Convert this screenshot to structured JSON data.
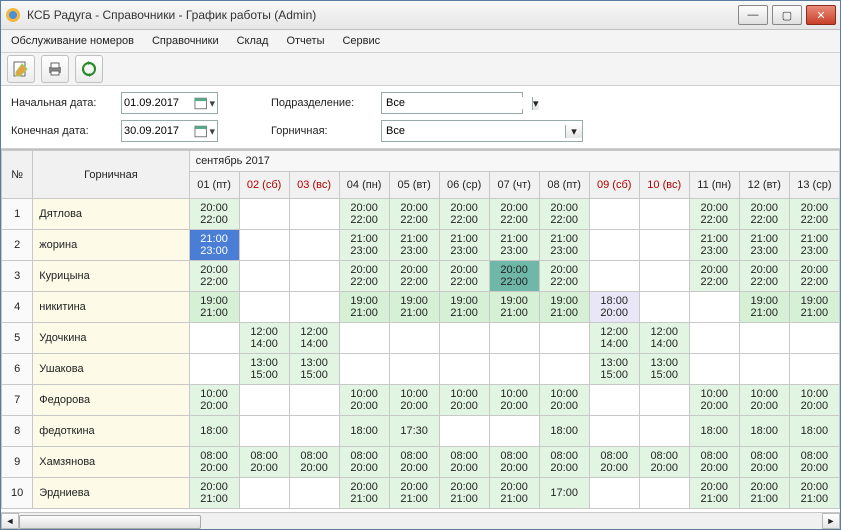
{
  "window": {
    "title": "КСБ Радуга - Справочники - График работы (Admin)"
  },
  "menubar": [
    "Обслуживание номеров",
    "Справочники",
    "Склад",
    "Отчеты",
    "Сервис"
  ],
  "filters": {
    "start_label": "Начальная дата:",
    "start_value": "01.09.2017",
    "end_label": "Конечная дата:",
    "end_value": "30.09.2017",
    "dept_label": "Подразделение:",
    "dept_value": "Все",
    "maid_label": "Горничная:",
    "maid_value": "Все"
  },
  "grid": {
    "num_header": "№",
    "name_header": "Горничная",
    "month_header": "сентябрь 2017",
    "days": [
      {
        "label": "01 (пт)",
        "weekend": false
      },
      {
        "label": "02 (сб)",
        "weekend": true
      },
      {
        "label": "03 (вс)",
        "weekend": true
      },
      {
        "label": "04 (пн)",
        "weekend": false
      },
      {
        "label": "05 (вт)",
        "weekend": false
      },
      {
        "label": "06 (ср)",
        "weekend": false
      },
      {
        "label": "07 (чт)",
        "weekend": false
      },
      {
        "label": "08 (пт)",
        "weekend": false
      },
      {
        "label": "09 (сб)",
        "weekend": true
      },
      {
        "label": "10 (вс)",
        "weekend": true
      },
      {
        "label": "11 (пн)",
        "weekend": false
      },
      {
        "label": "12 (вт)",
        "weekend": false
      },
      {
        "label": "13 (ср)",
        "weekend": false
      }
    ],
    "rows": [
      {
        "num": "1",
        "name": "Дятлова",
        "cells": [
          {
            "t1": "20:00",
            "t2": "22:00",
            "cls": "shift"
          },
          {
            "cls": ""
          },
          {
            "cls": ""
          },
          {
            "t1": "20:00",
            "t2": "22:00",
            "cls": "shift"
          },
          {
            "t1": "20:00",
            "t2": "22:00",
            "cls": "shift"
          },
          {
            "t1": "20:00",
            "t2": "22:00",
            "cls": "shift"
          },
          {
            "t1": "20:00",
            "t2": "22:00",
            "cls": "shift"
          },
          {
            "t1": "20:00",
            "t2": "22:00",
            "cls": "shift"
          },
          {
            "cls": ""
          },
          {
            "cls": ""
          },
          {
            "t1": "20:00",
            "t2": "22:00",
            "cls": "shift"
          },
          {
            "t1": "20:00",
            "t2": "22:00",
            "cls": "shift"
          },
          {
            "t1": "20:00",
            "t2": "22:00",
            "cls": "shift"
          }
        ]
      },
      {
        "num": "2",
        "name": "жорина",
        "cells": [
          {
            "t1": "21:00",
            "t2": "23:00",
            "cls": "sel-blue"
          },
          {
            "cls": ""
          },
          {
            "cls": ""
          },
          {
            "t1": "21:00",
            "t2": "23:00",
            "cls": "shift"
          },
          {
            "t1": "21:00",
            "t2": "23:00",
            "cls": "shift"
          },
          {
            "t1": "21:00",
            "t2": "23:00",
            "cls": "shift"
          },
          {
            "t1": "21:00",
            "t2": "23:00",
            "cls": "shift"
          },
          {
            "t1": "21:00",
            "t2": "23:00",
            "cls": "shift"
          },
          {
            "cls": ""
          },
          {
            "cls": ""
          },
          {
            "t1": "21:00",
            "t2": "23:00",
            "cls": "shift"
          },
          {
            "t1": "21:00",
            "t2": "23:00",
            "cls": "shift"
          },
          {
            "t1": "21:00",
            "t2": "23:00",
            "cls": "shift"
          }
        ]
      },
      {
        "num": "3",
        "name": "Курицына",
        "cells": [
          {
            "t1": "20:00",
            "t2": "22:00",
            "cls": "shift"
          },
          {
            "cls": ""
          },
          {
            "cls": ""
          },
          {
            "t1": "20:00",
            "t2": "22:00",
            "cls": "shift"
          },
          {
            "t1": "20:00",
            "t2": "22:00",
            "cls": "shift"
          },
          {
            "t1": "20:00",
            "t2": "22:00",
            "cls": "shift"
          },
          {
            "t1": "20:00",
            "t2": "22:00",
            "cls": "sel-teal"
          },
          {
            "t1": "20:00",
            "t2": "22:00",
            "cls": "shift"
          },
          {
            "cls": ""
          },
          {
            "cls": ""
          },
          {
            "t1": "20:00",
            "t2": "22:00",
            "cls": "shift"
          },
          {
            "t1": "20:00",
            "t2": "22:00",
            "cls": "shift"
          },
          {
            "t1": "20:00",
            "t2": "22:00",
            "cls": "shift"
          }
        ]
      },
      {
        "num": "4",
        "name": "никитина",
        "cells": [
          {
            "t1": "19:00",
            "t2": "21:00",
            "cls": "shift-alt"
          },
          {
            "cls": ""
          },
          {
            "cls": ""
          },
          {
            "t1": "19:00",
            "t2": "21:00",
            "cls": "shift-alt"
          },
          {
            "t1": "19:00",
            "t2": "21:00",
            "cls": "shift-alt"
          },
          {
            "t1": "19:00",
            "t2": "21:00",
            "cls": "shift-alt"
          },
          {
            "t1": "19:00",
            "t2": "21:00",
            "cls": "shift-alt"
          },
          {
            "t1": "19:00",
            "t2": "21:00",
            "cls": "shift-alt"
          },
          {
            "t1": "18:00",
            "t2": "20:00",
            "cls": "sel-lav"
          },
          {
            "cls": ""
          },
          {
            "cls": ""
          },
          {
            "t1": "19:00",
            "t2": "21:00",
            "cls": "shift-alt"
          },
          {
            "t1": "19:00",
            "t2": "21:00",
            "cls": "shift-alt"
          }
        ]
      },
      {
        "num": "5",
        "name": "Удочкина",
        "cells": [
          {
            "cls": ""
          },
          {
            "t1": "12:00",
            "t2": "14:00",
            "cls": "shift"
          },
          {
            "t1": "12:00",
            "t2": "14:00",
            "cls": "shift"
          },
          {
            "cls": ""
          },
          {
            "cls": ""
          },
          {
            "cls": ""
          },
          {
            "cls": ""
          },
          {
            "cls": ""
          },
          {
            "t1": "12:00",
            "t2": "14:00",
            "cls": "shift"
          },
          {
            "t1": "12:00",
            "t2": "14:00",
            "cls": "shift"
          },
          {
            "cls": ""
          },
          {
            "cls": ""
          },
          {
            "cls": ""
          }
        ]
      },
      {
        "num": "6",
        "name": "Ушакова",
        "cells": [
          {
            "cls": ""
          },
          {
            "t1": "13:00",
            "t2": "15:00",
            "cls": "shift"
          },
          {
            "t1": "13:00",
            "t2": "15:00",
            "cls": "shift"
          },
          {
            "cls": ""
          },
          {
            "cls": ""
          },
          {
            "cls": ""
          },
          {
            "cls": ""
          },
          {
            "cls": ""
          },
          {
            "t1": "13:00",
            "t2": "15:00",
            "cls": "shift"
          },
          {
            "t1": "13:00",
            "t2": "15:00",
            "cls": "shift"
          },
          {
            "cls": ""
          },
          {
            "cls": ""
          },
          {
            "cls": ""
          }
        ]
      },
      {
        "num": "7",
        "name": "Федорова",
        "cells": [
          {
            "t1": "10:00",
            "t2": "20:00",
            "cls": "shift"
          },
          {
            "cls": ""
          },
          {
            "cls": ""
          },
          {
            "t1": "10:00",
            "t2": "20:00",
            "cls": "shift"
          },
          {
            "t1": "10:00",
            "t2": "20:00",
            "cls": "shift"
          },
          {
            "t1": "10:00",
            "t2": "20:00",
            "cls": "shift"
          },
          {
            "t1": "10:00",
            "t2": "20:00",
            "cls": "shift"
          },
          {
            "t1": "10:00",
            "t2": "20:00",
            "cls": "shift"
          },
          {
            "cls": ""
          },
          {
            "cls": ""
          },
          {
            "t1": "10:00",
            "t2": "20:00",
            "cls": "shift"
          },
          {
            "t1": "10:00",
            "t2": "20:00",
            "cls": "shift"
          },
          {
            "t1": "10:00",
            "t2": "20:00",
            "cls": "shift"
          }
        ]
      },
      {
        "num": "8",
        "name": "федоткина",
        "cells": [
          {
            "t1": "18:00",
            "t2": "",
            "cls": "shift"
          },
          {
            "cls": ""
          },
          {
            "cls": ""
          },
          {
            "t1": "18:00",
            "t2": "",
            "cls": "shift"
          },
          {
            "t1": "17:30",
            "t2": "",
            "cls": "shift"
          },
          {
            "cls": ""
          },
          {
            "cls": ""
          },
          {
            "t1": "18:00",
            "t2": "",
            "cls": "shift"
          },
          {
            "cls": ""
          },
          {
            "cls": ""
          },
          {
            "t1": "18:00",
            "t2": "",
            "cls": "shift"
          },
          {
            "t1": "18:00",
            "t2": "",
            "cls": "shift"
          },
          {
            "t1": "18:00",
            "t2": "",
            "cls": "shift"
          }
        ]
      },
      {
        "num": "9",
        "name": "Хамзянова",
        "cells": [
          {
            "t1": "08:00",
            "t2": "20:00",
            "cls": "shift"
          },
          {
            "t1": "08:00",
            "t2": "20:00",
            "cls": "shift"
          },
          {
            "t1": "08:00",
            "t2": "20:00",
            "cls": "shift"
          },
          {
            "t1": "08:00",
            "t2": "20:00",
            "cls": "shift"
          },
          {
            "t1": "08:00",
            "t2": "20:00",
            "cls": "shift"
          },
          {
            "t1": "08:00",
            "t2": "20:00",
            "cls": "shift"
          },
          {
            "t1": "08:00",
            "t2": "20:00",
            "cls": "shift"
          },
          {
            "t1": "08:00",
            "t2": "20:00",
            "cls": "shift"
          },
          {
            "t1": "08:00",
            "t2": "20:00",
            "cls": "shift"
          },
          {
            "t1": "08:00",
            "t2": "20:00",
            "cls": "shift"
          },
          {
            "t1": "08:00",
            "t2": "20:00",
            "cls": "shift"
          },
          {
            "t1": "08:00",
            "t2": "20:00",
            "cls": "shift"
          },
          {
            "t1": "08:00",
            "t2": "20:00",
            "cls": "shift"
          }
        ]
      },
      {
        "num": "10",
        "name": "Эрдниева",
        "cells": [
          {
            "t1": "20:00",
            "t2": "21:00",
            "cls": "shift"
          },
          {
            "cls": ""
          },
          {
            "cls": ""
          },
          {
            "t1": "20:00",
            "t2": "21:00",
            "cls": "shift"
          },
          {
            "t1": "20:00",
            "t2": "21:00",
            "cls": "shift"
          },
          {
            "t1": "20:00",
            "t2": "21:00",
            "cls": "shift"
          },
          {
            "t1": "20:00",
            "t2": "21:00",
            "cls": "shift"
          },
          {
            "t1": "17:00",
            "t2": "",
            "cls": "shift"
          },
          {
            "cls": ""
          },
          {
            "cls": ""
          },
          {
            "t1": "20:00",
            "t2": "21:00",
            "cls": "shift"
          },
          {
            "t1": "20:00",
            "t2": "21:00",
            "cls": "shift"
          },
          {
            "t1": "20:00",
            "t2": "21:00",
            "cls": "shift"
          }
        ]
      }
    ]
  }
}
